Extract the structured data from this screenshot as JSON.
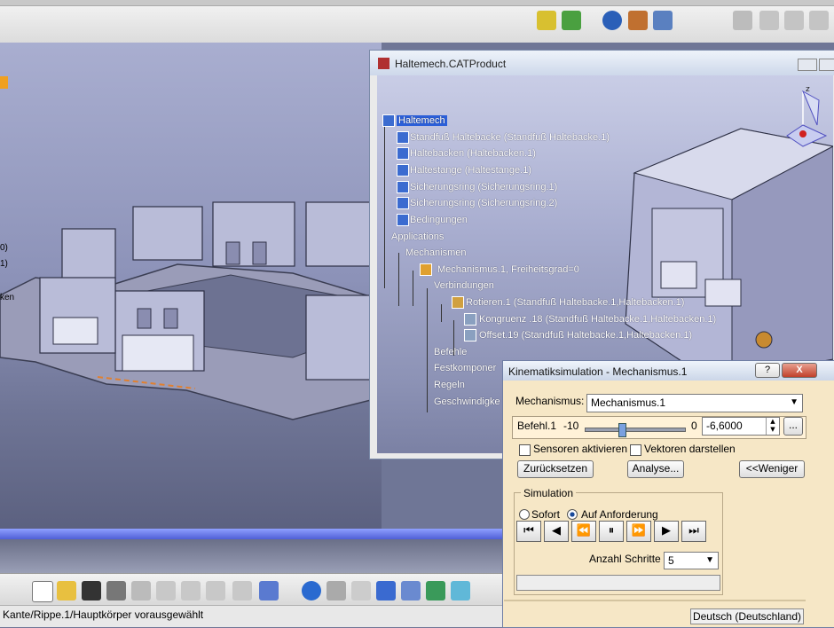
{
  "product_window": {
    "title": "Haltemech.CATProduct",
    "tree": [
      "Haltemech",
      "Standfuß Haltebacke (Standfuß Haltebacke.1)",
      "Haltebacken (Haltebacken.1)",
      "Haltestange (Haltestange.1)",
      "Sicherungsring (Sicherungsring.1)",
      "Sicherungsring (Sicherungsring.2)",
      "Bedingungen",
      "Applications",
      "Mechanismen",
      "Mechanismus.1, Freiheitsgrad=0",
      "Verbindungen",
      "Rotieren.1 (Standfuß Haltebacke.1,Haltebacken.1)",
      "Kongruenz .18 (Standfuß Haltebacke.1,Haltebacken.1)",
      "Offset.19 (Standfuß Haltebacke.1,Haltebacken.1)",
      "Befehle",
      "Festkomponer",
      "Regeln",
      "Geschwindigke"
    ],
    "compass_axis_label": "z"
  },
  "dialog": {
    "title": "Kinematiksimulation - Mechanismus.1",
    "help_label": "?",
    "close_label": "X",
    "mechanism_label": "Mechanismus:",
    "mechanism_value": "Mechanismus.1",
    "command_label": "Befehl.1",
    "slider_min": "-10",
    "slider_max": "0",
    "slider_value": "-6,6000",
    "slider_fraction": 0.34,
    "more_button": "...",
    "sensors_label": "Sensoren aktivieren",
    "vectors_label": "Vektoren darstellen",
    "reset_button": "Zurücksetzen",
    "analysis_button": "Analyse...",
    "less_button": "<<Weniger",
    "simulation_group": "Simulation",
    "radio_immediate": "Sofort",
    "radio_on_demand": "Auf Anforderung",
    "selected_radio": "Auf Anforderung",
    "steps_label": "Anzahl Schritte",
    "steps_value": "5",
    "language_badge": "Deutsch (Deutschland)"
  },
  "left_edge_labels": [
    "1)",
    "0)",
    "1)",
    "ken"
  ],
  "status_bar": {
    "text": "Kante/Rippe.1/Hauptkörper vorausgewählt"
  },
  "colors": {
    "dialog_bg": "#f6e7c6",
    "viewport_top": "#a9aed0",
    "viewport_bottom": "#555a78",
    "selection": "#2b5fd9",
    "progress_strip": "#4f5fd6"
  }
}
